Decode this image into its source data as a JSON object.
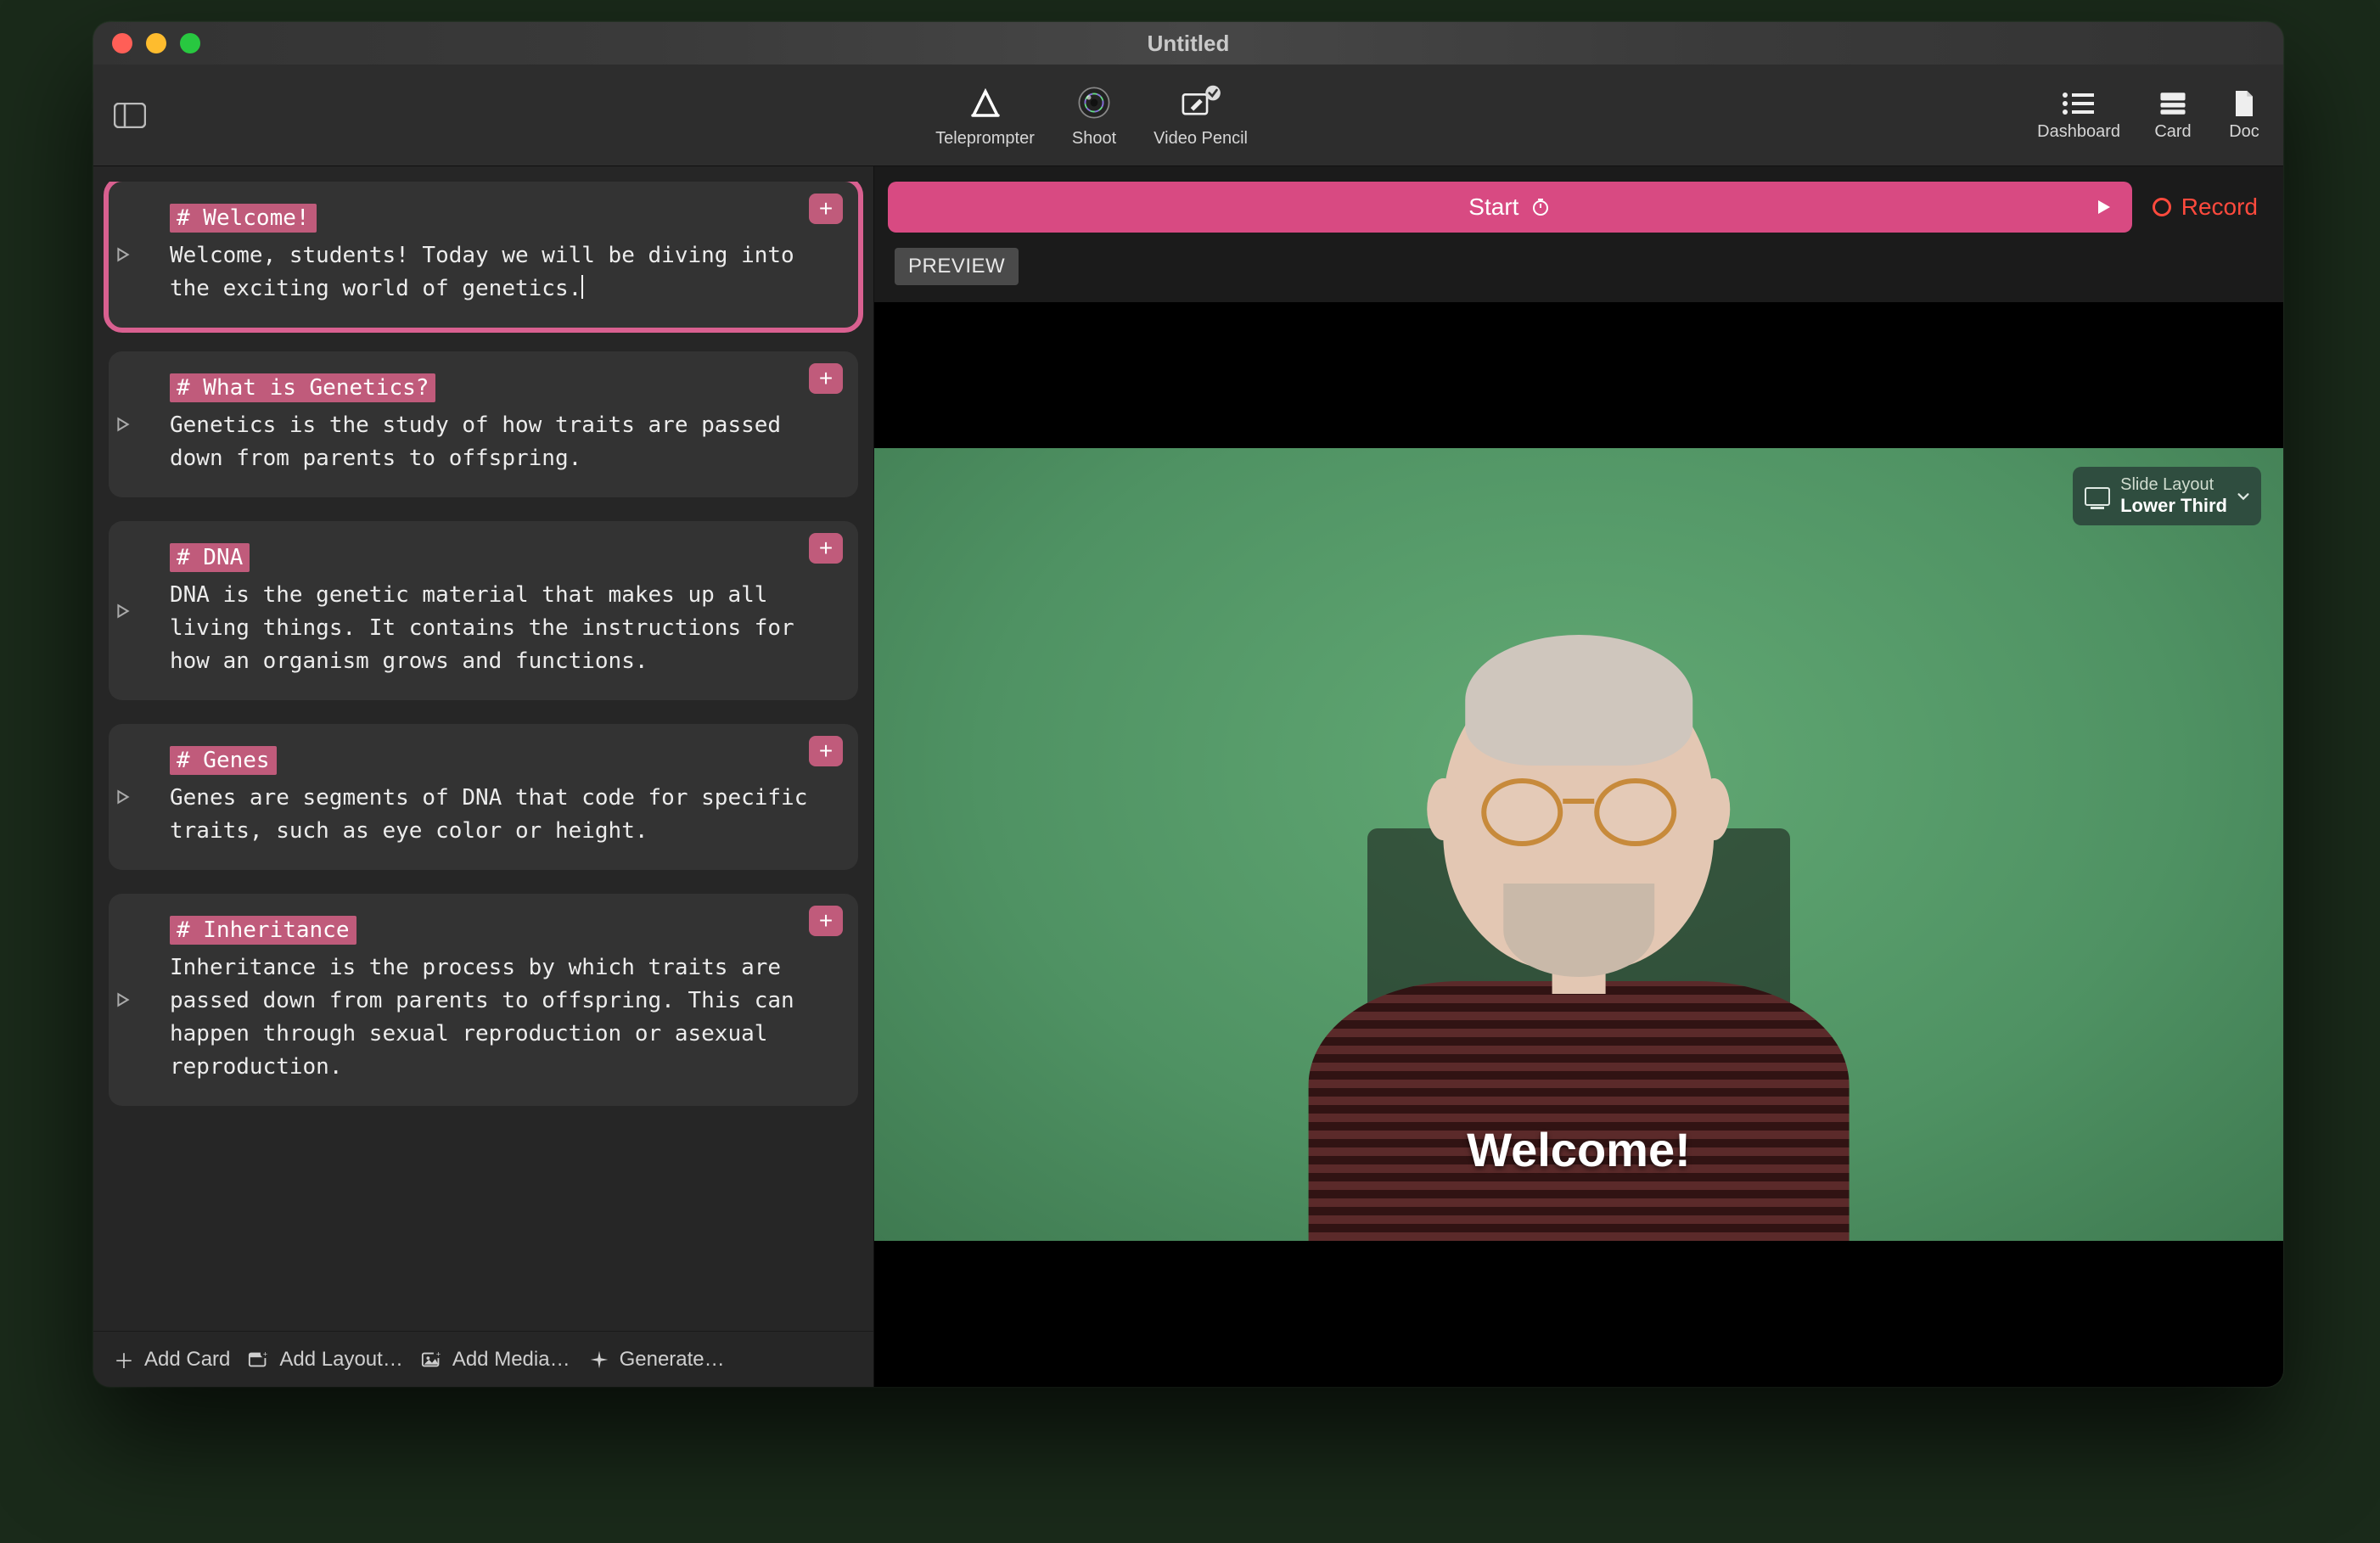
{
  "window": {
    "title": "Untitled"
  },
  "toolbar": {
    "modes": [
      {
        "id": "teleprompter",
        "label": "Teleprompter"
      },
      {
        "id": "shoot",
        "label": "Shoot"
      },
      {
        "id": "videopencil",
        "label": "Video Pencil"
      }
    ],
    "right": [
      {
        "id": "dashboard",
        "label": "Dashboard"
      },
      {
        "id": "card",
        "label": "Card"
      },
      {
        "id": "doc",
        "label": "Doc"
      }
    ]
  },
  "cards": [
    {
      "heading": "# Welcome!",
      "body": "Welcome, students! Today we will be diving into the exciting world of genetics.",
      "selected": true
    },
    {
      "heading": "# What is Genetics?",
      "body": "Genetics is the study of how traits are passed down from parents to offspring.",
      "selected": false
    },
    {
      "heading": "# DNA",
      "body": "DNA is the genetic material that makes up all living things. It contains the instructions for how an organism grows and functions.",
      "selected": false
    },
    {
      "heading": "# Genes",
      "body": "Genes are segments of DNA that code for specific traits, such as eye color or height.",
      "selected": false
    },
    {
      "heading": "# Inheritance",
      "body": "Inheritance is the process by which traits are passed down from parents to offspring. This can happen through sexual reproduction or asexual reproduction.",
      "selected": false
    }
  ],
  "left_actions": {
    "add_card": "Add Card",
    "add_layout": "Add Layout…",
    "add_media": "Add Media…",
    "generate": "Generate…"
  },
  "preview": {
    "start_label": "Start",
    "record_label": "Record",
    "chip": "PREVIEW",
    "overlay_title": "Welcome!",
    "layout": {
      "label": "Slide Layout",
      "value": "Lower Third"
    }
  }
}
